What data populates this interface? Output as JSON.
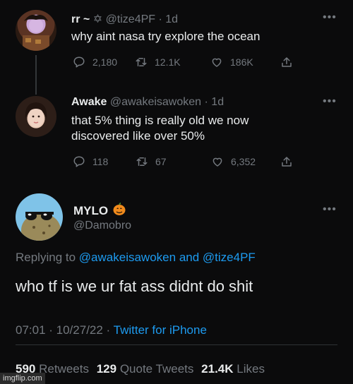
{
  "tweet1": {
    "display_name": "rr ~",
    "symbol": "✡",
    "handle": "@tize4PF",
    "time": "· 1d",
    "text": "why aint nasa try explore the ocean",
    "replies": "2,180",
    "retweets": "12.1K",
    "likes": "186K"
  },
  "tweet2": {
    "display_name": "Awake",
    "handle": "@awakeisawoken",
    "time": "· 1d",
    "text_line1": "that 5% thing is really old we now",
    "text_line2": "discovered like over 50%",
    "replies": "118",
    "retweets": "67",
    "likes": "6,352"
  },
  "tweet3": {
    "display_name": "MYLO",
    "handle": "@Damobro",
    "replying_prefix": "Replying to",
    "replying_to_1": "@awakeisawoken",
    "replying_and": "and",
    "replying_to_2": "@tize4PF",
    "text": "who tf is we ur fat ass didnt do shit",
    "timestamp": "07:01 · 10/27/22 ·",
    "source": "Twitter for iPhone",
    "retweets_count": "590",
    "retweets_label": "Retweets",
    "quotes_count": "129",
    "quotes_label": "Quote Tweets",
    "likes_count": "21.4K",
    "likes_label": "Likes"
  },
  "watermark": "imgflip.com",
  "colors": {
    "background": "#0b0b0c",
    "text": "#e9ebec",
    "muted": "#74797f",
    "accent": "#1d9bf0",
    "pumpkin": "#f08a1c"
  },
  "icons": [
    "reply-icon",
    "retweet-icon",
    "like-icon",
    "share-icon",
    "more-icon",
    "pumpkin-icon"
  ]
}
